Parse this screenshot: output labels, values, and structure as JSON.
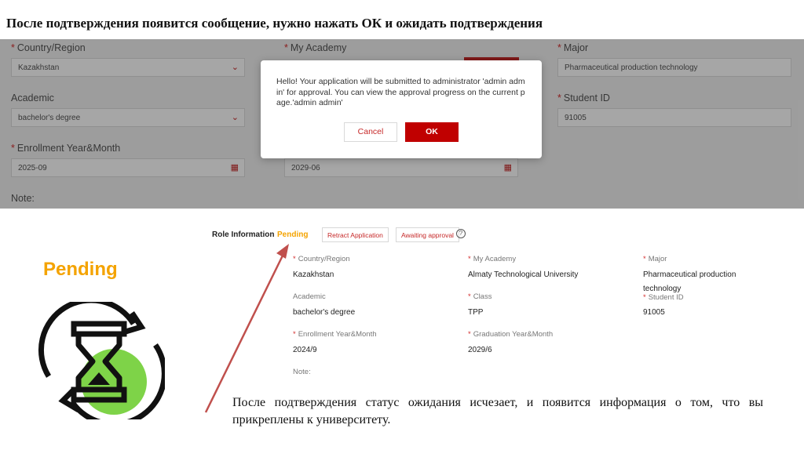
{
  "heading": "После подтверждения появится сообщение, нужно нажать ОК и ожидать подтверждения",
  "form": {
    "country_label": "Country/Region",
    "country_value": "Kazakhstan",
    "academy_label": "My Academy",
    "major_label": "Major",
    "major_value": "Pharmaceutical production technology",
    "academic_label": "Academic",
    "academic_value": "bachelor's degree",
    "student_id_label": "Student ID",
    "student_id_value": "91005",
    "enrollment_label": "Enrollment Year&Month",
    "enrollment_value": "2025-09",
    "graduation_value": "2029-06",
    "note_label": "Note:"
  },
  "dialog": {
    "message": "Hello! Your application will be submitted to administrator 'admin admin' for approval. You can view the approval progress on the current page.'admin admin'",
    "cancel_label": "Cancel",
    "ok_label": "OK"
  },
  "illustration": {
    "pending_label": "Pending"
  },
  "role_info": {
    "title": "Role Information",
    "status": "Pending",
    "retract_label": "Retract Application",
    "awaiting_label": "Awaiting approval",
    "help_icon": "?",
    "fields": {
      "country_label": "Country/Region",
      "country_value": "Kazakhstan",
      "academy_label": "My Academy",
      "academy_value": "Almaty Technological University",
      "major_label": "Major",
      "major_value_line1": "Pharmaceutical production",
      "major_value_line2": "technology",
      "academic_label": "Academic",
      "academic_value": "bachelor's degree",
      "class_label": "Class",
      "class_value": "TPP",
      "student_id_label": "Student ID",
      "student_id_value": "91005",
      "enrollment_label": "Enrollment Year&Month",
      "enrollment_value": "2024/9",
      "graduation_label": "Graduation Year&Month",
      "graduation_value": "2029/6",
      "note_label": "Note:"
    }
  },
  "caption": "После подтверждения статус ожидания исчезает, и появится информация о том, что вы прикреплены к университету.",
  "colors": {
    "accent_red": "#c00000",
    "pending_orange": "#f4a300",
    "hourglass_green": "#7ed348",
    "arrow_red": "#c0504d"
  }
}
